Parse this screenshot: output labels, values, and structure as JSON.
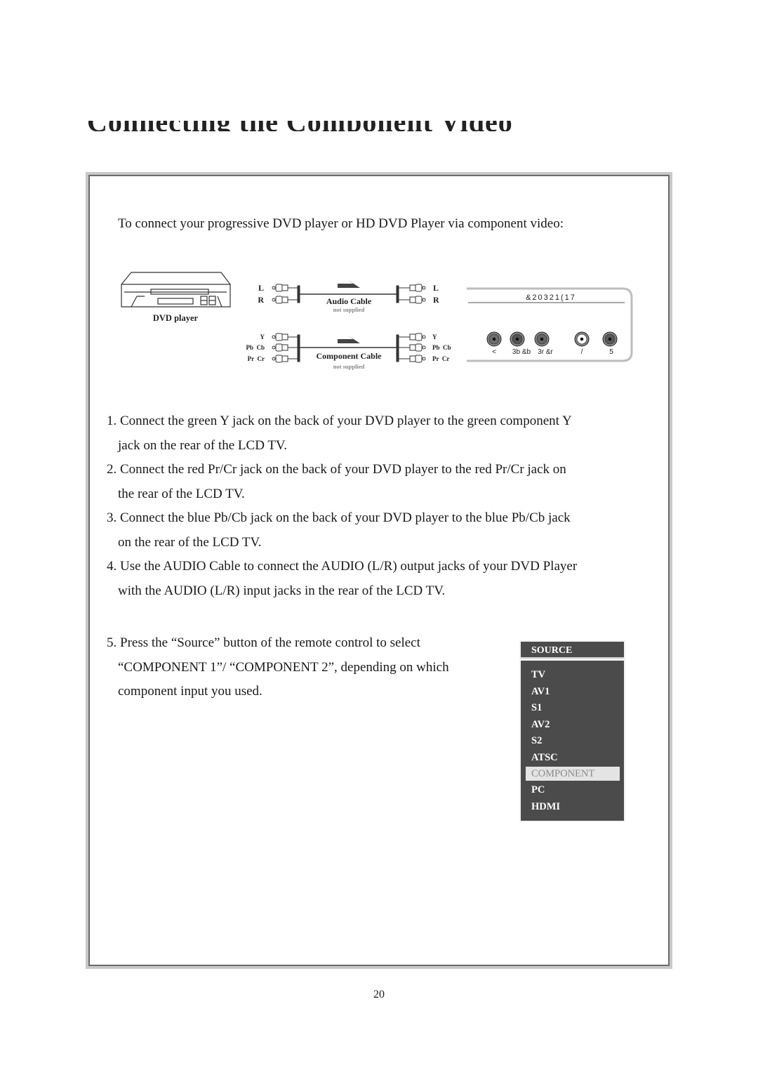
{
  "page": {
    "title": "Connecting the Component Video",
    "page_number": "20"
  },
  "intro": "To connect your progressive DVD player or HD DVD Player via component video:",
  "diagram": {
    "dvd_label": "DVD player",
    "audio_left_labels": [
      "L",
      "R"
    ],
    "audio_right_labels": [
      "L",
      "R"
    ],
    "audio_cable_label": "Audio Cable",
    "audio_cable_note": "not supplied",
    "component_left_labels": [
      "Y",
      "Pb  Cb",
      "Pr  Cr"
    ],
    "component_right_labels": [
      "Y",
      "Pb  Cb",
      "Pr  Cr"
    ],
    "component_cable_label": "Component Cable",
    "component_cable_note": "not supplied",
    "tv_panel_header": "&20321(17",
    "tv_jack_labels": [
      "<",
      "3b  &b",
      "3r  &r",
      "/",
      "5"
    ],
    "tv_jack_colors": [
      "#6e6e6e",
      "#555555",
      "#666666",
      "#ffffff",
      "#5a5a5a"
    ]
  },
  "steps": [
    {
      "line1": "1. Connect the green Y jack on the back of your DVD player to the green component Y",
      "line2": "jack on the rear of the LCD TV."
    },
    {
      "line1": "2. Connect the red Pr/Cr jack on the back of your DVD player to the red Pr/Cr jack on",
      "line2": "the rear of the LCD TV."
    },
    {
      "line1": "3. Connect the blue Pb/Cb jack on the back of your DVD player to the blue Pb/Cb jack",
      "line2": "on the rear of the LCD TV."
    },
    {
      "line1": "4.  Use the AUDIO Cable to connect the AUDIO (L/R) output jacks of your DVD Player",
      "line2": "with the AUDIO (L/R) input jacks in the rear of the LCD TV."
    },
    {
      "line1": "5. Press the “Source” button of the remote control to select",
      "line2": "“COMPONENT 1”/ “COMPONENT 2”, depending on which",
      "line3": "component input you used."
    }
  ],
  "source_menu": {
    "header": "SOURCE",
    "items": [
      "TV",
      "AV1",
      "S1",
      "AV2",
      "S2",
      "ATSC",
      "COMPONENT",
      "PC",
      "HDMI"
    ],
    "selected": "COMPONENT"
  }
}
